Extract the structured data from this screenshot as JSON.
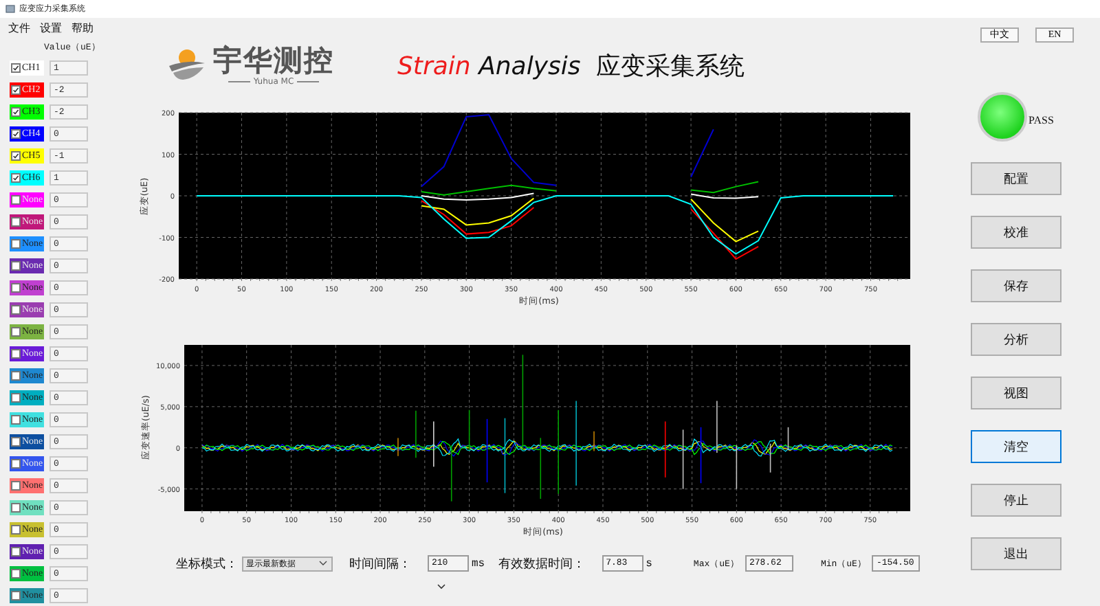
{
  "window": {
    "title": "应变应力采集系统"
  },
  "menu": [
    "文件",
    "设置",
    "帮助"
  ],
  "channel_header": "Value（uE）",
  "channels": [
    {
      "name": "CH1",
      "color": "#ffffff",
      "checked": true,
      "value": "1"
    },
    {
      "name": "CH2",
      "color": "#ff0000",
      "checked": true,
      "value": "-2"
    },
    {
      "name": "CH3",
      "color": "#00ff00",
      "checked": true,
      "value": "-2"
    },
    {
      "name": "CH4",
      "color": "#0000ff",
      "checked": true,
      "value": "0"
    },
    {
      "name": "CH5",
      "color": "#ffff00",
      "checked": true,
      "value": "-1"
    },
    {
      "name": "CH6",
      "color": "#00ffff",
      "checked": true,
      "value": "1"
    },
    {
      "name": "None",
      "color": "#ff00ff",
      "checked": false,
      "value": "0"
    },
    {
      "name": "None",
      "color": "#c0187a",
      "checked": false,
      "value": "0"
    },
    {
      "name": "None",
      "color": "#1e90ff",
      "checked": false,
      "value": "0"
    },
    {
      "name": "None",
      "color": "#6a2bb0",
      "checked": false,
      "value": "0"
    },
    {
      "name": "None",
      "color": "#c040d0",
      "checked": false,
      "value": "0"
    },
    {
      "name": "None",
      "color": "#9a3db0",
      "checked": false,
      "value": "0"
    },
    {
      "name": "None",
      "color": "#7cb342",
      "checked": false,
      "value": "0"
    },
    {
      "name": "None",
      "color": "#6a1bd8",
      "checked": false,
      "value": "0"
    },
    {
      "name": "None",
      "color": "#1e88d0",
      "checked": false,
      "value": "0"
    },
    {
      "name": "None",
      "color": "#00aec0",
      "checked": false,
      "value": "0"
    },
    {
      "name": "None",
      "color": "#40e0e0",
      "checked": false,
      "value": "0"
    },
    {
      "name": "None",
      "color": "#0d4fa0",
      "checked": false,
      "value": "0"
    },
    {
      "name": "None",
      "color": "#3355ee",
      "checked": false,
      "value": "0"
    },
    {
      "name": "None",
      "color": "#ff7070",
      "checked": false,
      "value": "0"
    },
    {
      "name": "None",
      "color": "#70e0c0",
      "checked": false,
      "value": "0"
    },
    {
      "name": "None",
      "color": "#c8c030",
      "checked": false,
      "value": "0"
    },
    {
      "name": "None",
      "color": "#6020b0",
      "checked": false,
      "value": "0"
    },
    {
      "name": "None",
      "color": "#00c040",
      "checked": false,
      "value": "0"
    },
    {
      "name": "None",
      "color": "#2090a0",
      "checked": false,
      "value": "0"
    }
  ],
  "header": {
    "brand": "宇华测控",
    "brand_sub": "Yuhua MC",
    "title_accent": "Strain",
    "title_main": "Analysis",
    "title_cn": "应变采集系统"
  },
  "languages": [
    "中文",
    "EN"
  ],
  "status": {
    "label": "PASS",
    "on": true
  },
  "buttons": [
    {
      "label": "配置",
      "focused": false
    },
    {
      "label": "校准",
      "focused": false
    },
    {
      "label": "保存",
      "focused": false
    },
    {
      "label": "分析",
      "focused": false
    },
    {
      "label": "视图",
      "focused": false
    },
    {
      "label": "清空",
      "focused": true
    },
    {
      "label": "停止",
      "focused": false
    },
    {
      "label": "退出",
      "focused": false
    }
  ],
  "strain_chart": {
    "chart_data": {
      "type": "line",
      "xlabel": "时间(ms)",
      "ylabel": "应变(uE)",
      "x": [
        0,
        25,
        50,
        75,
        100,
        125,
        150,
        175,
        200,
        225,
        250,
        275,
        300,
        325,
        350,
        375,
        400,
        425,
        450,
        475,
        500,
        525,
        550,
        575,
        600,
        625,
        650,
        675,
        700,
        725,
        750,
        775
      ],
      "series": [
        {
          "color": "#ffffff",
          "values": [
            null,
            null,
            null,
            null,
            null,
            null,
            null,
            null,
            null,
            null,
            0,
            -8,
            -10,
            -8,
            -4,
            6,
            null,
            null,
            null,
            null,
            null,
            null,
            4,
            -5,
            -6,
            -2,
            null,
            null,
            null,
            null,
            null,
            null
          ]
        },
        {
          "color": "#ff0000",
          "values": [
            null,
            null,
            null,
            null,
            null,
            null,
            null,
            null,
            null,
            null,
            -12,
            -45,
            -92,
            -88,
            -72,
            -28,
            null,
            null,
            null,
            null,
            null,
            null,
            -32,
            -90,
            -152,
            -122,
            null,
            null,
            null,
            null,
            null,
            null
          ]
        },
        {
          "color": "#00c000",
          "values": [
            null,
            null,
            null,
            null,
            null,
            null,
            null,
            null,
            null,
            null,
            10,
            2,
            10,
            18,
            25,
            18,
            12,
            null,
            null,
            null,
            null,
            null,
            14,
            8,
            22,
            34,
            null,
            null,
            null,
            null,
            null,
            null
          ]
        },
        {
          "color": "#0000d0",
          "values": [
            null,
            null,
            null,
            null,
            null,
            null,
            null,
            null,
            null,
            null,
            22,
            70,
            190,
            195,
            90,
            32,
            25,
            null,
            null,
            null,
            null,
            null,
            45,
            160,
            null,
            null,
            null,
            null,
            null,
            null,
            null,
            null
          ]
        },
        {
          "color": "#ffff00",
          "values": [
            null,
            null,
            null,
            null,
            null,
            null,
            null,
            null,
            null,
            null,
            -24,
            -32,
            -70,
            -65,
            -48,
            -6,
            null,
            null,
            null,
            null,
            null,
            null,
            -8,
            -65,
            -110,
            -85,
            null,
            null,
            null,
            null,
            null,
            null
          ]
        },
        {
          "color": "#00ffff",
          "values": [
            0,
            0,
            0,
            0,
            0,
            0,
            0,
            0,
            0,
            0,
            -4,
            -56,
            -102,
            -100,
            -60,
            -16,
            0,
            0,
            0,
            0,
            0,
            0,
            -20,
            -100,
            -140,
            -108,
            -5,
            0,
            0,
            0,
            0,
            0
          ]
        }
      ],
      "xlim": [
        -20,
        794
      ],
      "ylim": [
        -200,
        200
      ],
      "grid": true,
      "xticks": [
        0,
        50,
        100,
        150,
        200,
        250,
        300,
        350,
        400,
        450,
        500,
        550,
        600,
        650,
        700,
        750
      ],
      "yticks": [
        -200,
        -100,
        0,
        100,
        200
      ]
    }
  },
  "rate_chart": {
    "xlabel": "时间(ms)",
    "ylabel": "应变速率(uE/s)",
    "ytick_labels": [
      "10,000",
      "5,000",
      "0",
      "-5,000"
    ],
    "xtick_labels": [
      "0",
      "50",
      "100",
      "150",
      "200",
      "250",
      "300",
      "350",
      "400",
      "450",
      "500",
      "550",
      "600",
      "650",
      "700",
      "750"
    ]
  },
  "controls": [
    {
      "kind": "select",
      "label": "坐标模式：",
      "value": "显示最新数据"
    },
    {
      "kind": "input",
      "label": "时间间隔：",
      "value": "210",
      "unit": "ms"
    },
    {
      "kind": "input",
      "label": "有效数据时间：",
      "value": "7.83",
      "unit": "s"
    },
    {
      "kind": "input",
      "label": "Max（uE）",
      "value": "278.62"
    },
    {
      "kind": "input",
      "label": "Min（uE）",
      "value": "-154.50"
    }
  ]
}
